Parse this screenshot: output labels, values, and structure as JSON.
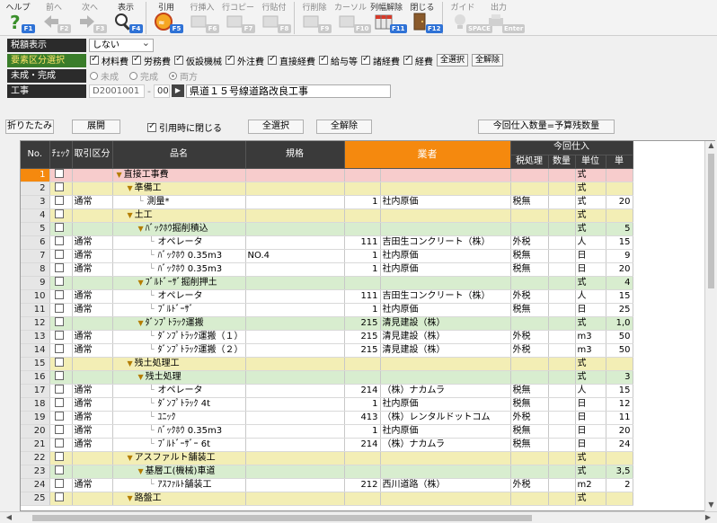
{
  "toolbar": [
    {
      "label": "ヘルプ",
      "key": "F1",
      "icon": "help-icon",
      "disabled": false
    },
    {
      "label": "前へ",
      "key": "F2",
      "icon": "arrow-left-icon",
      "disabled": true
    },
    {
      "label": "次へ",
      "key": "F3",
      "icon": "arrow-right-icon",
      "disabled": true
    },
    {
      "label": "表示",
      "key": "F4",
      "icon": "search-icon",
      "disabled": false
    },
    {
      "label": "引用",
      "key": "F5",
      "icon": "quote-icon",
      "disabled": false
    },
    {
      "label": "行挿入",
      "key": "F6",
      "icon": "row-insert-icon",
      "disabled": true
    },
    {
      "label": "行コピー",
      "key": "F7",
      "icon": "row-copy-icon",
      "disabled": true
    },
    {
      "label": "行貼付",
      "key": "F8",
      "icon": "row-paste-icon",
      "disabled": true
    },
    {
      "label": "行削除",
      "key": "F9",
      "icon": "row-delete-icon",
      "disabled": true
    },
    {
      "label": "カーソル",
      "key": "F10",
      "icon": "cursor-icon",
      "disabled": true
    },
    {
      "label": "列幅解除",
      "key": "F11",
      "icon": "column-width-icon",
      "disabled": false
    },
    {
      "label": "閉じる",
      "key": "F12",
      "icon": "close-door-icon",
      "disabled": false
    },
    {
      "label": "ガイド",
      "key": "SPACE",
      "icon": "guide-icon",
      "disabled": true
    },
    {
      "label": "出力",
      "key": "Enter",
      "icon": "output-icon",
      "disabled": true
    }
  ],
  "settings": {
    "tax_label": "税額表示",
    "tax_value": "しない",
    "element_label": "要素区分選択",
    "elements": [
      {
        "label": "材料費",
        "checked": true
      },
      {
        "label": "労務費",
        "checked": true
      },
      {
        "label": "仮設機械",
        "checked": true
      },
      {
        "label": "外注費",
        "checked": true
      },
      {
        "label": "直接経費",
        "checked": true
      },
      {
        "label": "給与等",
        "checked": true
      },
      {
        "label": "諸経費",
        "checked": true
      },
      {
        "label": "経費",
        "checked": true
      }
    ],
    "select_all": "全選択",
    "clear_all": "全解除",
    "status_label": "未成・完成",
    "status_options": [
      "未成",
      "完成",
      "両方"
    ],
    "status_selected": "両方",
    "project_label": "工事",
    "project_code": "D2001001",
    "project_sub": "00",
    "project_name": "県道１５号線道路改良工事"
  },
  "actions": {
    "collapse": "折りたたみ",
    "expand": "展開",
    "close_on_quote": "引用時に閉じる",
    "select_all": "全選択",
    "clear_all": "全解除",
    "qty_btn": "今回仕入数量=予算残数量"
  },
  "grid": {
    "headers": {
      "no": "No.",
      "check": "ﾁｪｯｸ",
      "kind": "取引区分",
      "name": "品名",
      "spec": "規格",
      "vendor": "業者",
      "purchase_group": "今回仕入",
      "tax": "税処理",
      "qty": "数量",
      "unit": "単位",
      "price": "単"
    },
    "rows": [
      {
        "no": "1",
        "kind": "",
        "name": "直接工事費",
        "spec": "",
        "code": "",
        "vendor": "",
        "tax": "",
        "qty": "",
        "unit": "式",
        "price": "",
        "color": "pink",
        "indent": 0,
        "fold": true
      },
      {
        "no": "2",
        "kind": "",
        "name": "準備工",
        "spec": "",
        "code": "",
        "vendor": "",
        "tax": "",
        "qty": "",
        "unit": "式",
        "price": "",
        "color": "yellow",
        "indent": 1,
        "fold": true
      },
      {
        "no": "3",
        "kind": "通常",
        "name": "測量*",
        "spec": "",
        "code": "1",
        "vendor": "社内原価",
        "tax": "税無",
        "qty": "",
        "unit": "式",
        "price": "20",
        "color": "white",
        "indent": 2,
        "fold": false
      },
      {
        "no": "4",
        "kind": "",
        "name": "土工",
        "spec": "",
        "code": "",
        "vendor": "",
        "tax": "",
        "qty": "",
        "unit": "式",
        "price": "",
        "color": "yellow",
        "indent": 1,
        "fold": true
      },
      {
        "no": "5",
        "kind": "",
        "name": "ﾊﾞｯｸﾎｳ掘削積込",
        "spec": "",
        "code": "",
        "vendor": "",
        "tax": "",
        "qty": "",
        "unit": "式",
        "price": "5",
        "color": "green",
        "indent": 2,
        "fold": true
      },
      {
        "no": "6",
        "kind": "通常",
        "name": "オペレータ",
        "spec": "",
        "code": "111",
        "vendor": "吉田生コンクリート（株）",
        "tax": "外税",
        "qty": "",
        "unit": "人",
        "price": "15",
        "color": "white",
        "indent": 3,
        "fold": false
      },
      {
        "no": "7",
        "kind": "通常",
        "name": "ﾊﾞｯｸﾎｳ 0.35m3",
        "spec": "NO.4",
        "code": "1",
        "vendor": "社内原価",
        "tax": "税無",
        "qty": "",
        "unit": "日",
        "price": "9",
        "color": "white",
        "indent": 3,
        "fold": false
      },
      {
        "no": "8",
        "kind": "通常",
        "name": "ﾊﾞｯｸﾎｳ 0.35m3",
        "spec": "",
        "code": "1",
        "vendor": "社内原価",
        "tax": "税無",
        "qty": "",
        "unit": "日",
        "price": "20",
        "color": "white",
        "indent": 3,
        "fold": false
      },
      {
        "no": "9",
        "kind": "",
        "name": "ﾌﾞﾙﾄﾞｰｻﾞ掘削押土",
        "spec": "",
        "code": "",
        "vendor": "",
        "tax": "",
        "qty": "",
        "unit": "式",
        "price": "4",
        "color": "green",
        "indent": 2,
        "fold": true
      },
      {
        "no": "10",
        "kind": "通常",
        "name": "オペレータ",
        "spec": "",
        "code": "111",
        "vendor": "吉田生コンクリート（株）",
        "tax": "外税",
        "qty": "",
        "unit": "人",
        "price": "15",
        "color": "white",
        "indent": 3,
        "fold": false
      },
      {
        "no": "11",
        "kind": "通常",
        "name": "ﾌﾞﾙﾄﾞｰｻﾞ",
        "spec": "",
        "code": "1",
        "vendor": "社内原価",
        "tax": "税無",
        "qty": "",
        "unit": "日",
        "price": "25",
        "color": "white",
        "indent": 3,
        "fold": false
      },
      {
        "no": "12",
        "kind": "",
        "name": "ﾀﾞﾝﾌﾟﾄﾗｯｸ運搬",
        "spec": "",
        "code": "215",
        "vendor": "清見建設（株）",
        "tax": "",
        "qty": "",
        "unit": "式",
        "price": "1,0",
        "color": "green",
        "indent": 2,
        "fold": true
      },
      {
        "no": "13",
        "kind": "通常",
        "name": "ﾀﾞﾝﾌﾟﾄﾗｯｸ運搬（１）",
        "spec": "",
        "code": "215",
        "vendor": "清見建設（株）",
        "tax": "外税",
        "qty": "",
        "unit": "m3",
        "price": "50",
        "color": "white",
        "indent": 3,
        "fold": false
      },
      {
        "no": "14",
        "kind": "通常",
        "name": "ﾀﾞﾝﾌﾟﾄﾗｯｸ運搬（２）",
        "spec": "",
        "code": "215",
        "vendor": "清見建設（株）",
        "tax": "外税",
        "qty": "",
        "unit": "m3",
        "price": "50",
        "color": "white",
        "indent": 3,
        "fold": false
      },
      {
        "no": "15",
        "kind": "",
        "name": "残土処理工",
        "spec": "",
        "code": "",
        "vendor": "",
        "tax": "",
        "qty": "",
        "unit": "式",
        "price": "",
        "color": "yellow",
        "indent": 1,
        "fold": true
      },
      {
        "no": "16",
        "kind": "",
        "name": "残土処理",
        "spec": "",
        "code": "",
        "vendor": "",
        "tax": "",
        "qty": "",
        "unit": "式",
        "price": "3",
        "color": "green",
        "indent": 2,
        "fold": true
      },
      {
        "no": "17",
        "kind": "通常",
        "name": "オペレータ",
        "spec": "",
        "code": "214",
        "vendor": "（株）ナカムラ",
        "tax": "税無",
        "qty": "",
        "unit": "人",
        "price": "15",
        "color": "white",
        "indent": 3,
        "fold": false
      },
      {
        "no": "18",
        "kind": "通常",
        "name": "ﾀﾞﾝﾌﾟﾄﾗｯｸ 4t",
        "spec": "",
        "code": "1",
        "vendor": "社内原価",
        "tax": "税無",
        "qty": "",
        "unit": "日",
        "price": "12",
        "color": "white",
        "indent": 3,
        "fold": false
      },
      {
        "no": "19",
        "kind": "通常",
        "name": "ﾕﾆｯｸ",
        "spec": "",
        "code": "413",
        "vendor": "（株）レンタルドットコム",
        "tax": "外税",
        "qty": "",
        "unit": "日",
        "price": "11",
        "color": "white",
        "indent": 3,
        "fold": false
      },
      {
        "no": "20",
        "kind": "通常",
        "name": "ﾊﾞｯｸﾎｳ 0.35m3",
        "spec": "",
        "code": "1",
        "vendor": "社内原価",
        "tax": "税無",
        "qty": "",
        "unit": "日",
        "price": "20",
        "color": "white",
        "indent": 3,
        "fold": false
      },
      {
        "no": "21",
        "kind": "通常",
        "name": "ﾌﾞﾙﾄﾞｰｻﾞｰ 6t",
        "spec": "",
        "code": "214",
        "vendor": "（株）ナカムラ",
        "tax": "税無",
        "qty": "",
        "unit": "日",
        "price": "24",
        "color": "white",
        "indent": 3,
        "fold": false
      },
      {
        "no": "22",
        "kind": "",
        "name": "アスファルト舗装工",
        "spec": "",
        "code": "",
        "vendor": "",
        "tax": "",
        "qty": "",
        "unit": "式",
        "price": "",
        "color": "yellow",
        "indent": 1,
        "fold": true
      },
      {
        "no": "23",
        "kind": "",
        "name": "基層工(機械)車道",
        "spec": "",
        "code": "",
        "vendor": "",
        "tax": "",
        "qty": "",
        "unit": "式",
        "price": "3,5",
        "color": "green",
        "indent": 2,
        "fold": true
      },
      {
        "no": "24",
        "kind": "通常",
        "name": "ｱｽﾌｧﾙﾄ舗装工",
        "spec": "",
        "code": "212",
        "vendor": "西川道路（株）",
        "tax": "外税",
        "qty": "",
        "unit": "m2",
        "price": "2",
        "color": "white",
        "indent": 3,
        "fold": false
      },
      {
        "no": "25",
        "kind": "",
        "name": "路盤工",
        "spec": "",
        "code": "",
        "vendor": "",
        "tax": "",
        "qty": "",
        "unit": "式",
        "price": "",
        "color": "yellow",
        "indent": 1,
        "fold": true
      }
    ]
  }
}
